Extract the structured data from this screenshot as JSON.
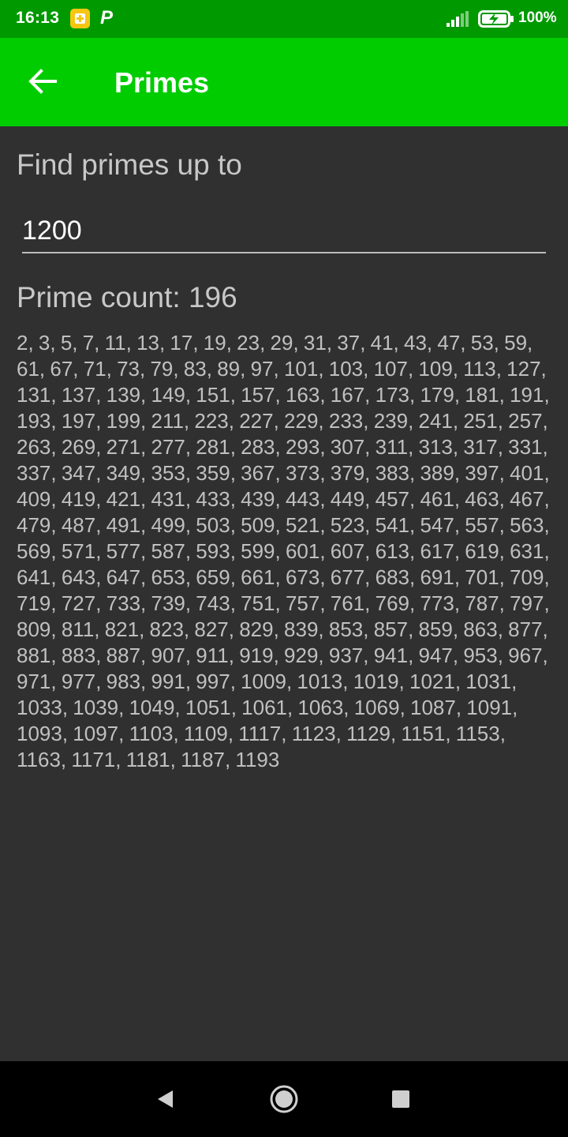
{
  "status_bar": {
    "time": "16:13",
    "battery_percent": "100%",
    "notification_icons": [
      "yellow-app-icon",
      "p-icon"
    ],
    "signal_icon": "signal-icon",
    "battery_icon": "battery-charging-icon"
  },
  "app_bar": {
    "title": "Primes",
    "back_icon": "arrow-left-icon",
    "color": "#00cc00"
  },
  "form": {
    "prompt_label": "Find primes up to",
    "limit_value": "1200"
  },
  "results": {
    "count_label": "Prime count: 196",
    "primes_text": "2, 3, 5, 7, 11, 13, 17, 19, 23, 29, 31, 37, 41, 43, 47, 53, 59, 61, 67, 71, 73, 79, 83, 89, 97, 101, 103, 107, 109, 113, 127, 131, 137, 139, 149, 151, 157, 163, 167, 173, 179, 181, 191, 193, 197, 199, 211, 223, 227, 229, 233, 239, 241, 251, 257, 263, 269, 271, 277, 281, 283, 293, 307, 311, 313, 317, 331, 337, 347, 349, 353, 359, 367, 373, 379, 383, 389, 397, 401, 409, 419, 421, 431, 433, 439, 443, 449, 457, 461, 463, 467, 479, 487, 491, 499, 503, 509, 521, 523, 541, 547, 557, 563, 569, 571, 577, 587, 593, 599, 601, 607, 613, 617, 619, 631, 641, 643, 647, 653, 659, 661, 673, 677, 683, 691, 701, 709, 719, 727, 733, 739, 743, 751, 757, 761, 769, 773, 787, 797, 809, 811, 821, 823, 827, 829, 839, 853, 857, 859, 863, 877, 881, 883, 887, 907, 911, 919, 929, 937, 941, 947, 953, 967, 971, 977, 983, 991, 997, 1009, 1013, 1019, 1021, 1031, 1033, 1039, 1049, 1051, 1061, 1063, 1069, 1087, 1091, 1093, 1097, 1103, 1109, 1117, 1123, 1129, 1151, 1153, 1163, 1171, 1181, 1187, 1193"
  },
  "nav_bar": {
    "back_icon": "triangle-back-icon",
    "home_icon": "circle-home-icon",
    "recents_icon": "square-recents-icon"
  }
}
